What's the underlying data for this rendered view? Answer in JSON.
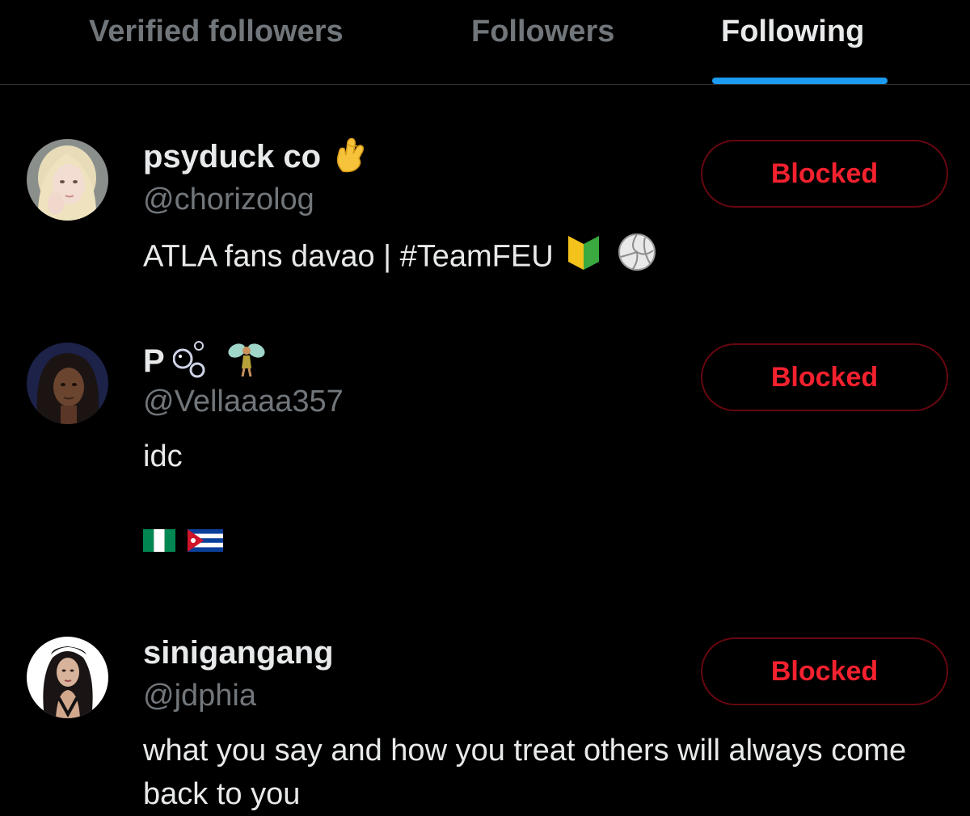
{
  "tabs": [
    {
      "label": "Verified followers",
      "active": false
    },
    {
      "label": "Followers",
      "active": false
    },
    {
      "label": "Following",
      "active": true
    }
  ],
  "colors": {
    "background": "#000000",
    "primary_text": "#e7e9ea",
    "secondary_text": "#71767b",
    "accent": "#1d9bf0",
    "blocked_red": "#f4212e",
    "blocked_border": "#67070f"
  },
  "users": [
    {
      "display_name": "psyduck co",
      "name_emoji": "crossed-fingers-icon",
      "handle": "@chorizolog",
      "bio_text": "ATLA fans davao | #TeamFEU",
      "bio_emojis": [
        "beginner-badge-icon",
        "volleyball-icon"
      ],
      "button_label": "Blocked"
    },
    {
      "display_name": "P",
      "name_emoji": "bubbles-fairy-icon",
      "handle": "@Vellaaaa357",
      "bio_text": "idc",
      "bio_emojis": [
        "flag-nigeria-icon",
        "flag-cuba-icon"
      ],
      "button_label": "Blocked"
    },
    {
      "display_name": "sinigangang",
      "handle": "@jdphia",
      "bio_text": "what you say and how you treat others will always come back to you",
      "button_label": "Blocked"
    }
  ]
}
